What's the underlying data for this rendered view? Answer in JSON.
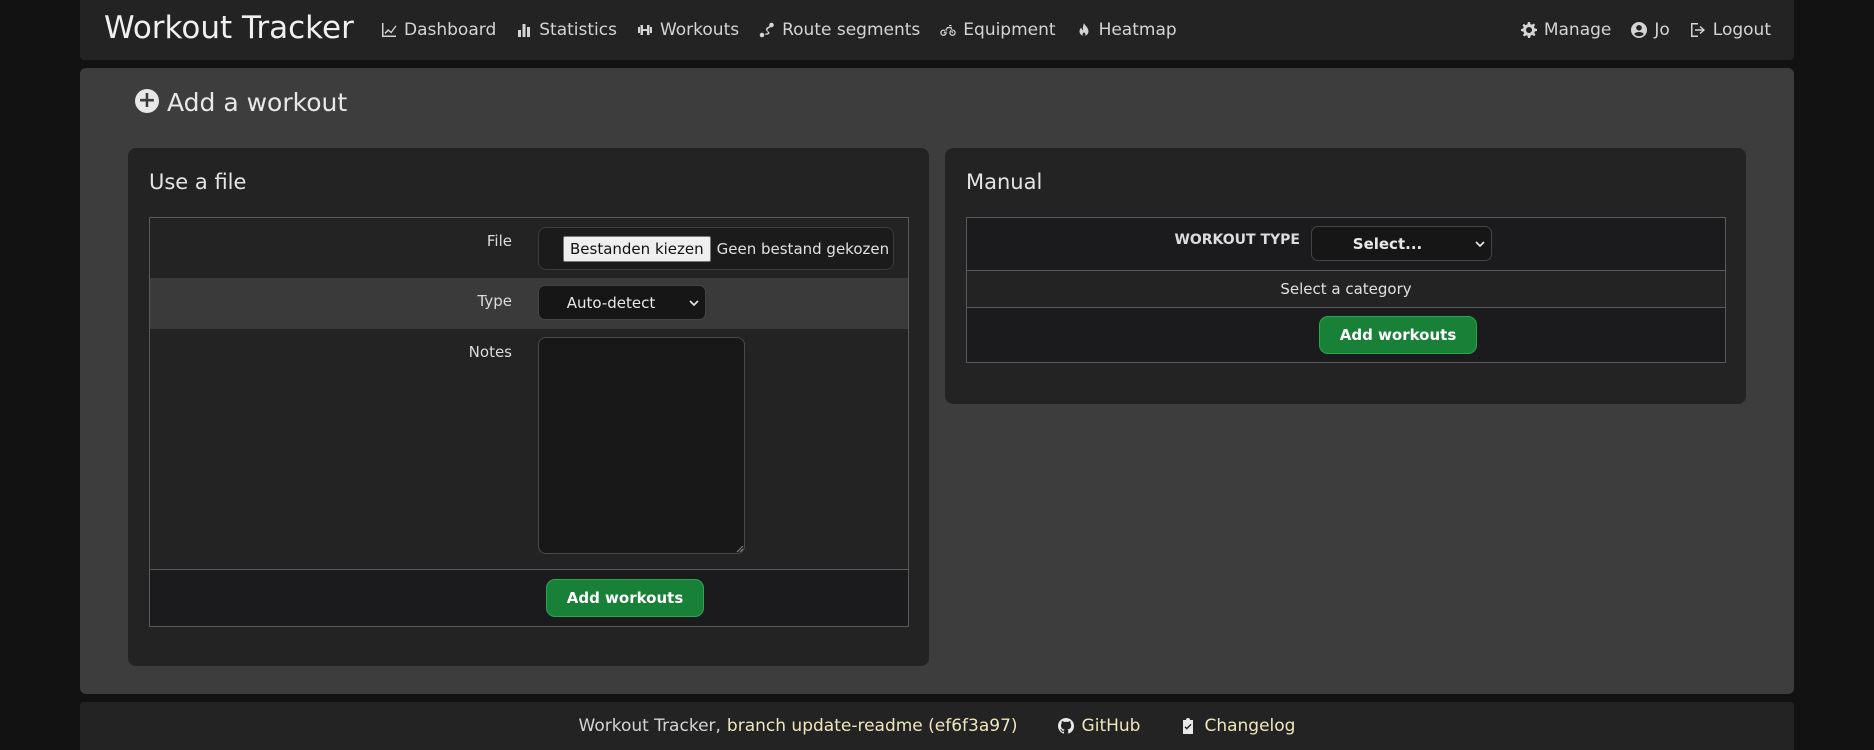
{
  "brand": "Workout Tracker",
  "nav": {
    "dashboard": "Dashboard",
    "statistics": "Statistics",
    "workouts": "Workouts",
    "route_segments": "Route segments",
    "equipment": "Equipment",
    "heatmap": "Heatmap",
    "manage": "Manage",
    "user": "Jo",
    "logout": "Logout"
  },
  "page_title": "Add a workout",
  "file_card": {
    "title": "Use a file",
    "file_label": "File",
    "file_button": "Bestanden kiezen",
    "file_status": "Geen bestand gekozen",
    "type_label": "Type",
    "type_value": "Auto-detect",
    "notes_label": "Notes",
    "notes_value": "",
    "submit": "Add workouts"
  },
  "manual_card": {
    "title": "Manual",
    "workout_type_label": "WORKOUT TYPE",
    "workout_type_value": "Select...",
    "hint": "Select a category",
    "submit": "Add workouts"
  },
  "footer": {
    "text": "Workout Tracker,",
    "branch": "branch update-readme (ef6f3a97)",
    "github": "GitHub",
    "changelog": "Changelog"
  },
  "colors": {
    "accent_green": "#198038",
    "page_bg": "#121212",
    "panel_bg": "#3d3d3d",
    "card_bg": "#232323"
  }
}
